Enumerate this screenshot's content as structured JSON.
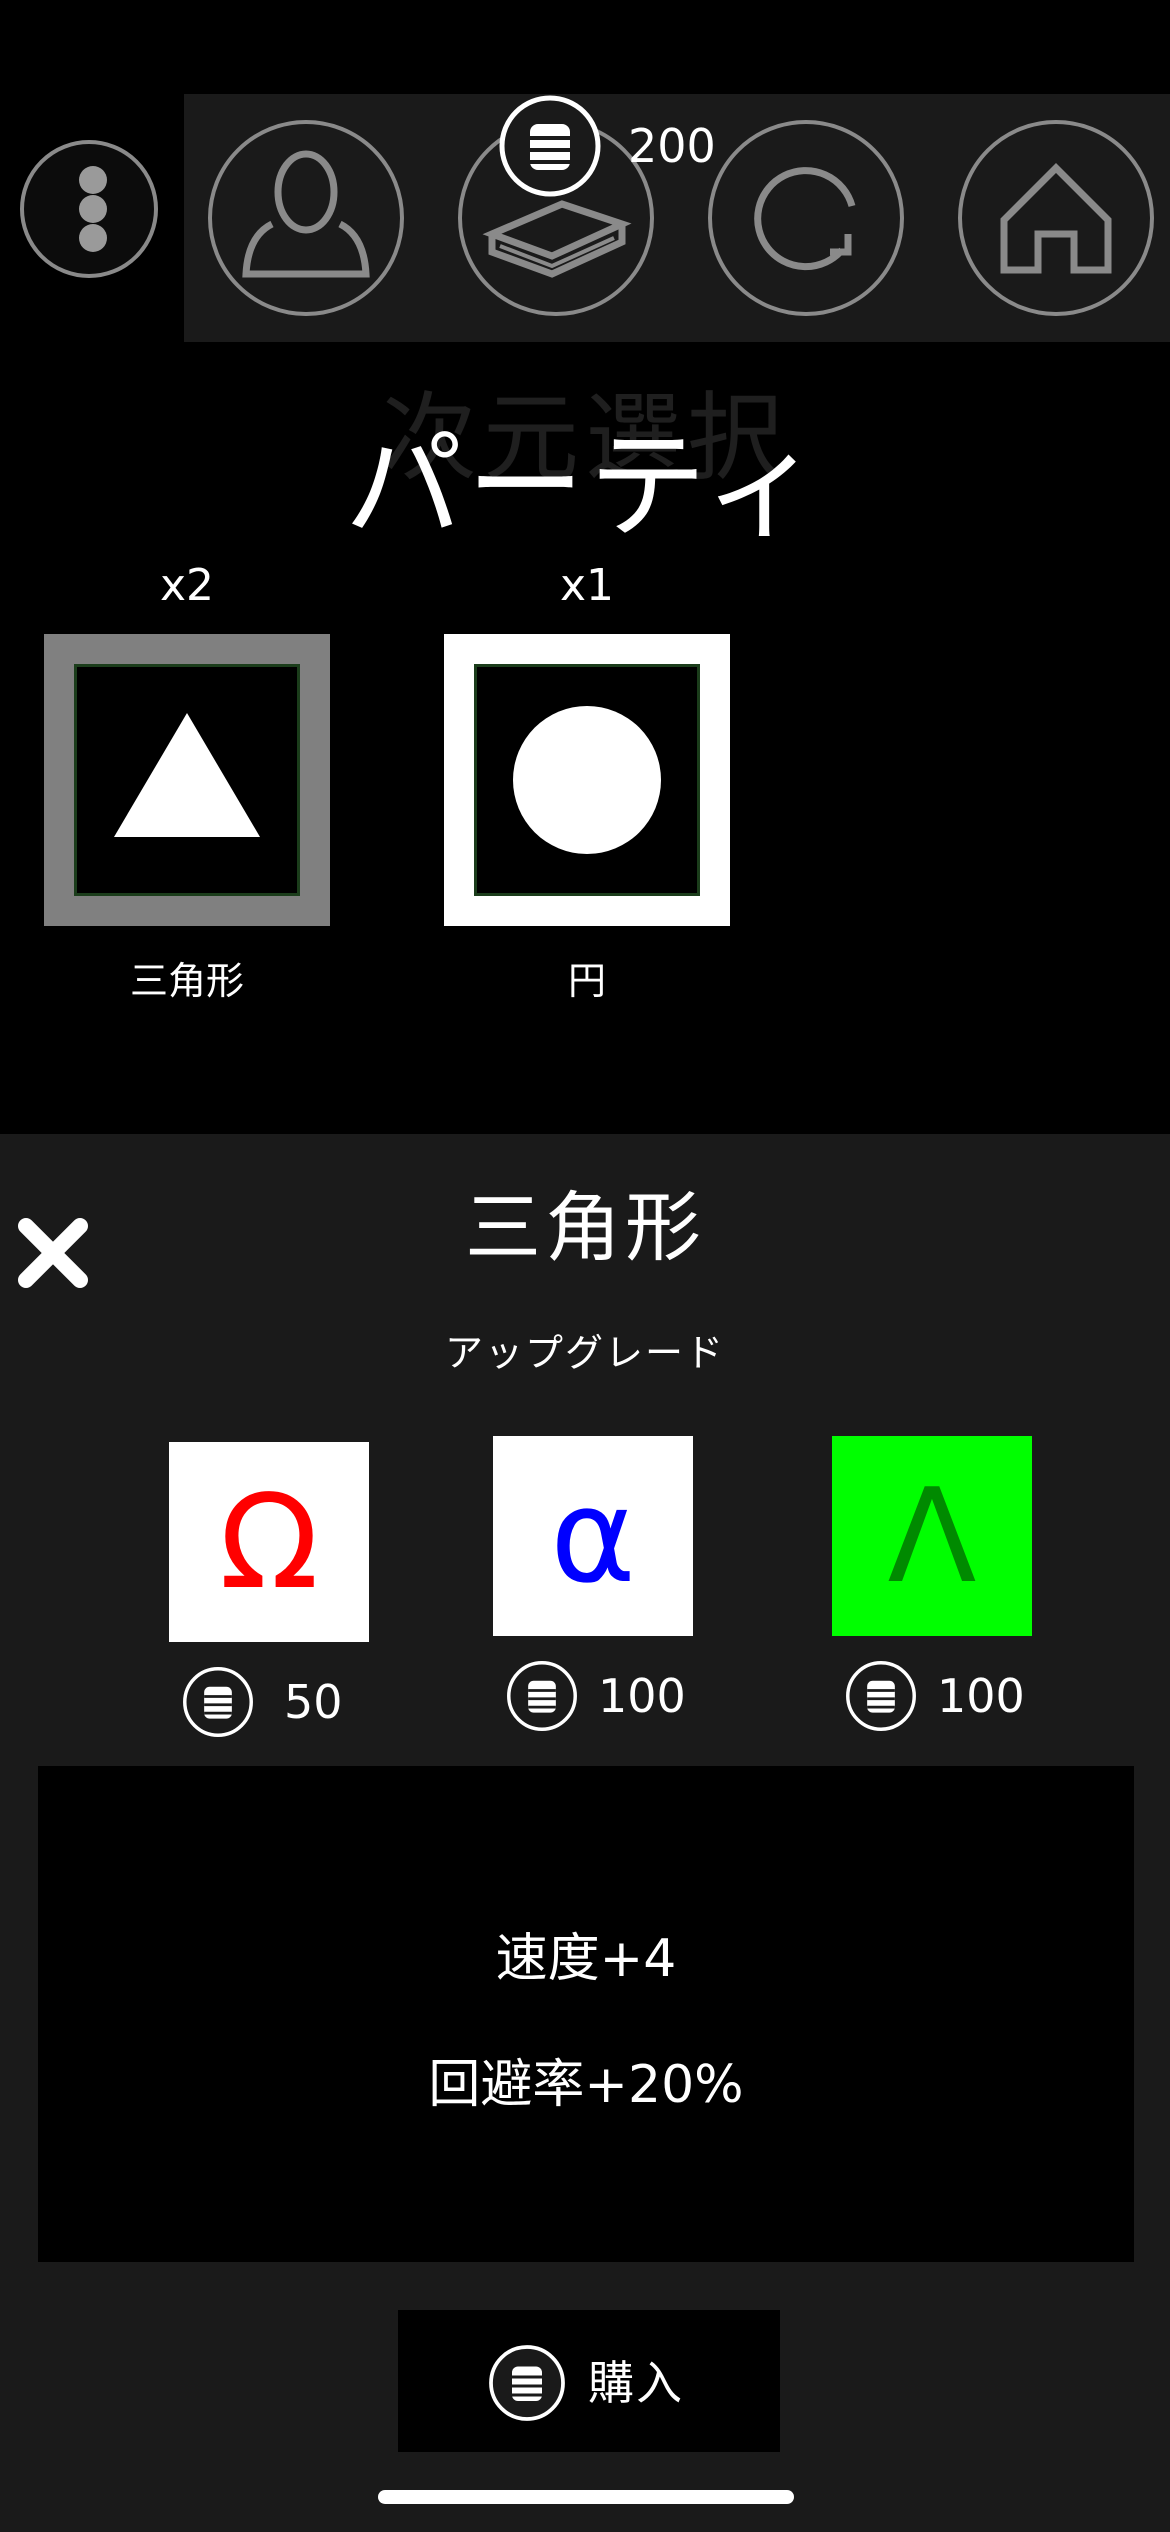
{
  "coins": {
    "count": "200"
  },
  "icons": {
    "menu": "more-vertical-icon",
    "profile": "user-icon",
    "book": "book-icon",
    "refresh": "refresh-icon",
    "home": "home-icon",
    "coin": "coin-stack-icon",
    "close": "close-icon"
  },
  "background_title": "次元選択",
  "party": {
    "title": "パーティ",
    "units": [
      {
        "name": "三角形",
        "count": "x2",
        "shape": "triangle",
        "frame_color": "#808080"
      },
      {
        "name": "円",
        "count": "x1",
        "shape": "circle",
        "frame_color": "#ffffff"
      }
    ]
  },
  "detail": {
    "title": "三角形",
    "upgrade_label": "アップグレード",
    "upgrades": [
      {
        "symbol": "Ω",
        "symbol_color": "#ff0000",
        "tile_color": "#ffffff",
        "price": "50"
      },
      {
        "symbol": "α",
        "symbol_color": "#0000ff",
        "tile_color": "#ffffff",
        "price": "100"
      },
      {
        "symbol": "Λ",
        "symbol_color": "#008a00",
        "tile_color": "#00ff00",
        "price": "100"
      }
    ],
    "stats": [
      "速度+4",
      "回避率+20%"
    ],
    "buy_label": "購入"
  }
}
